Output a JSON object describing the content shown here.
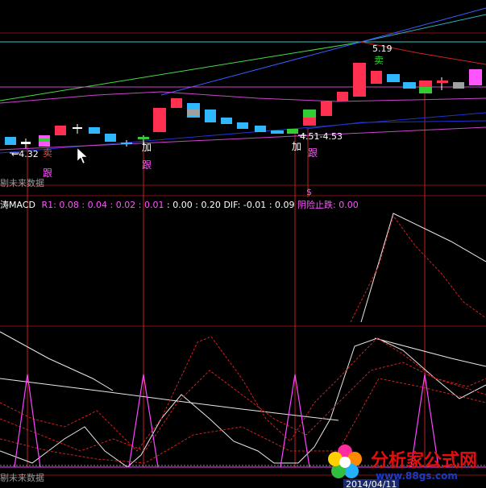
{
  "price_labels": {
    "low_value": "4.32",
    "high_value": "5.19",
    "range_value": "4.51-4.53"
  },
  "signals": {
    "sell_1": "卖",
    "follow_1": "跟",
    "add_1": "加",
    "follow_2": "跟",
    "add_2": "加",
    "follow_3": "跟",
    "sell_2": "卖",
    "dollar": "$"
  },
  "pane_labels": {
    "future_data_top": "剔未来数据",
    "future_data_bottom": "剔未来数据"
  },
  "indicator_header": {
    "name": "涛MACD",
    "r1_label": "R1:",
    "r1_values": [
      "0.08",
      "0.04",
      "0.02",
      "0.01"
    ],
    "sep1": ":",
    "values_white": [
      "0.00",
      "0.20"
    ],
    "dif_label": "DIF:",
    "dif_values": [
      "-0.01",
      "0.09"
    ],
    "stop_label": "阴险止跌:",
    "stop_value": "0.00"
  },
  "bottom_date": "2014/04/11",
  "watermark": {
    "name": "分析家公式网",
    "url": "www.88gs.com"
  },
  "colors": {
    "background": "#000000",
    "candle_up": "#ff3050",
    "candle_down": "#30b8ff",
    "indicator_pink": "#ff55ff",
    "grid_red": "#a01010"
  }
}
